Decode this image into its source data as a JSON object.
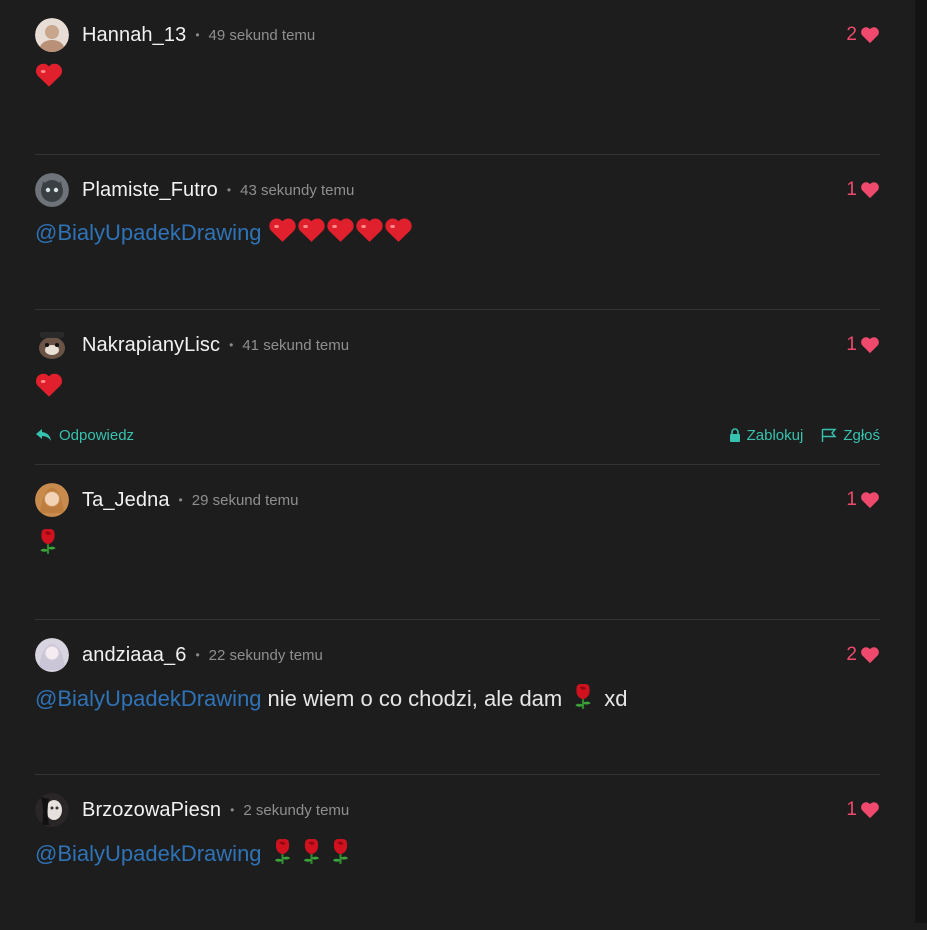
{
  "colors": {
    "background": "#1d1d1e",
    "mention": "#2f73b7",
    "like": "#ef4a6d",
    "action": "#36c2ae",
    "divider": "#333335"
  },
  "comments": [
    {
      "user": "Hannah_13",
      "time": "49 sekund temu",
      "likes": "2",
      "mention": "",
      "text": "",
      "emoji": [
        "heart"
      ]
    },
    {
      "user": "Plamiste_Futro",
      "time": "43 sekundy temu",
      "likes": "1",
      "mention": "@BialyUpadekDrawing",
      "text": "",
      "emoji": [
        "heart",
        "heart",
        "heart",
        "heart",
        "heart"
      ]
    },
    {
      "user": "NakrapianyLisc",
      "time": "41 sekund temu",
      "likes": "1",
      "mention": "",
      "text": "",
      "emoji": [
        "heart"
      ]
    },
    {
      "user": "Ta_Jedna",
      "time": "29 sekund temu",
      "likes": "1",
      "mention": "",
      "text": "",
      "emoji": [
        "rose"
      ]
    },
    {
      "user": "andziaaa_6",
      "time": "22 sekundy temu",
      "likes": "2",
      "mention": "@BialyUpadekDrawing",
      "text": "nie wiem o co chodzi, ale dam",
      "emoji": [
        "rose"
      ],
      "text_after": "xd"
    },
    {
      "user": "BrzozowaPiesn",
      "time": "2 sekundy temu",
      "likes": "1",
      "mention": "@BialyUpadekDrawing",
      "text": "",
      "emoji": [
        "rose",
        "rose",
        "rose"
      ]
    }
  ],
  "actions": {
    "reply": "Odpowiedz",
    "block": "Zablokuj",
    "report": "Zgłoś"
  }
}
